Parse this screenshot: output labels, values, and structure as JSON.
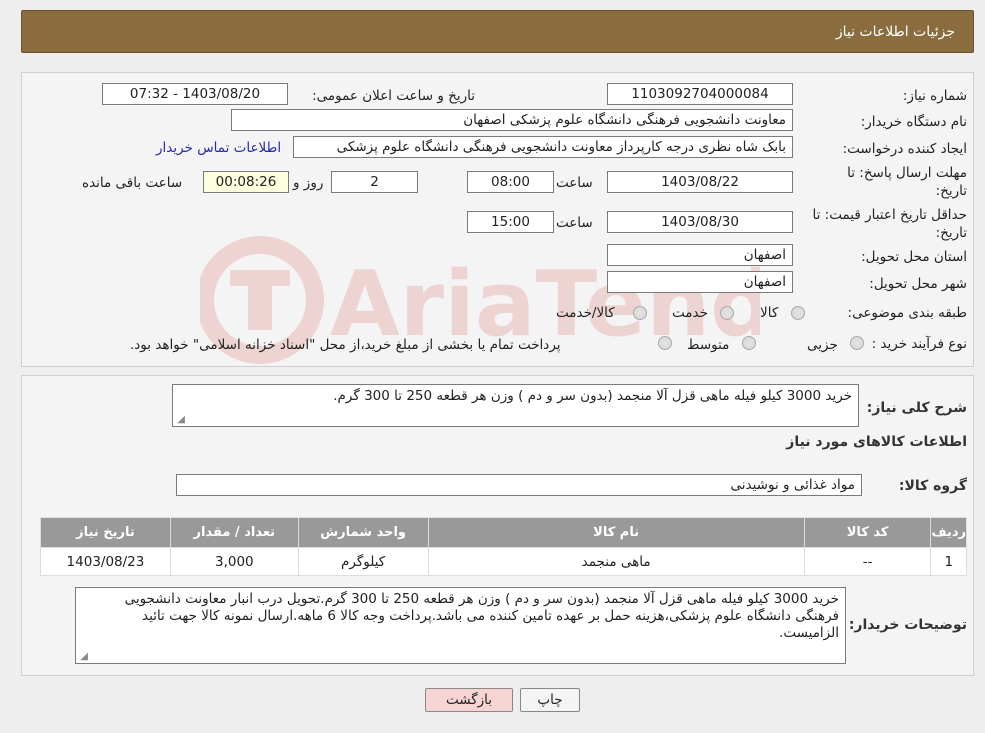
{
  "header": {
    "title": "جزئیات اطلاعات نیاز"
  },
  "form": {
    "need_number_label": "شماره نیاز:",
    "need_number": "1103092704000084",
    "announce_label": "تاریخ و ساعت اعلان عمومی:",
    "announce_value": "1403/08/20 - 07:32",
    "buyer_org_label": "نام دستگاه خریدار:",
    "buyer_org": "معاونت دانشجویی فرهنگی دانشگاه علوم پزشکی اصفهان",
    "requester_label": "ایجاد کننده درخواست:",
    "requester": "بابک شاه نظری درجه کارپرداز معاونت دانشجویی فرهنگی دانشگاه علوم پزشکی",
    "contact_link": "اطلاعات تماس خریدار",
    "deadline_label_1": "مهلت ارسال پاسخ: تا",
    "deadline_label_2": "تاریخ:",
    "deadline_date": "1403/08/22",
    "time_label": "ساعت",
    "deadline_time": "08:00",
    "days_value": "2",
    "days_label": "روز و",
    "remaining_time": "00:08:26",
    "remaining_label": "ساعت باقی مانده",
    "validity_label_1": "حداقل تاریخ اعتبار قیمت: تا",
    "validity_label_2": "تاریخ:",
    "validity_date": "1403/08/30",
    "validity_time": "15:00",
    "province_label": "استان محل تحویل:",
    "province": "اصفهان",
    "city_label": "شهر محل تحویل:",
    "city": "اصفهان",
    "category_label": "طبقه بندی موضوعی:",
    "category_options": [
      "کالا",
      "خدمت",
      "کالا/خدمت"
    ],
    "process_label": "نوع فرآیند خرید :",
    "process_options": [
      "جزیی",
      "متوسط"
    ],
    "payment_note": "پرداخت تمام یا بخشی از مبلغ خرید،از محل \"اسناد خزانه اسلامی\" خواهد بود."
  },
  "details": {
    "summary_label": "شرح کلی نیاز:",
    "summary": "خرید 3000 کیلو فیله ماهی قزل آلا منجمد (بدون سر و دم ) وزن هر قطعه 250 تا 300 گرم.",
    "goods_info_title": "اطلاعات کالاهای مورد نیاز",
    "goods_group_label": "گروه کالا:",
    "goods_group": "مواد غذائی و نوشیدنی",
    "table": {
      "headers": [
        "ردیف",
        "کد کالا",
        "نام کالا",
        "واحد شمارش",
        "تعداد / مقدار",
        "تاریخ نیاز"
      ],
      "rows": [
        [
          "1",
          "--",
          "ماهی منجمد",
          "کیلوگرم",
          "3,000",
          "1403/08/23"
        ]
      ]
    },
    "buyer_notes_label": "توضیحات خریدار:",
    "buyer_notes": "خرید 3000 کیلو فیله ماهی قزل آلا منجمد (بدون سر و دم ) وزن هر قطعه 250 تا 300 گرم.تحویل درب انبار معاونت دانشجویی فرهنگی دانشگاه علوم پزشکی،هزینه حمل بر عهده تامین کننده می باشد.پرداخت وجه کالا 6 ماهه.ارسال نمونه کالا جهت تائید الزامیست."
  },
  "buttons": {
    "print": "چاپ",
    "back": "بازگشت"
  },
  "colors": {
    "header": "#8b6c3e",
    "link": "#2a2aa8",
    "back_button": "#f6d4d4"
  }
}
